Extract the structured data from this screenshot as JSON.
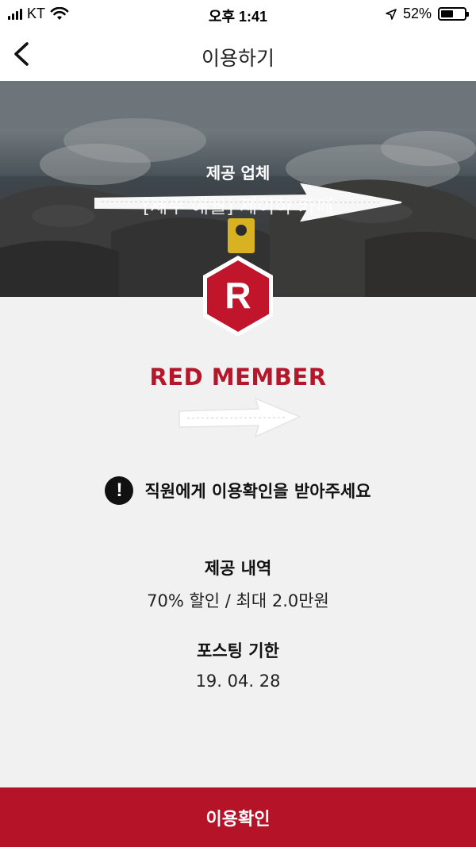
{
  "status_bar": {
    "carrier": "KT",
    "time": "오후 1:41",
    "battery": "52%",
    "battery_level": 0.52
  },
  "nav": {
    "title": "이용하기",
    "back_icon": "chevron-left-icon"
  },
  "hero": {
    "label": "제공 업체",
    "provider_name": "[제주 애월] 제이하 카페"
  },
  "badge": {
    "letter": "R",
    "color": "#c0152a"
  },
  "member_level": "RED MEMBER",
  "notice": {
    "icon": "exclamation-circle-icon",
    "text": "직원에게 이용확인을 받아주세요"
  },
  "offer": {
    "label": "제공 내역",
    "value": "70% 할인 / 최대 2.0만원"
  },
  "posting": {
    "label": "포스팅 기한",
    "value": "19. 04. 28"
  },
  "confirm_button": "이용확인",
  "colors": {
    "accent": "#b51428",
    "background": "#f2f1f2"
  }
}
